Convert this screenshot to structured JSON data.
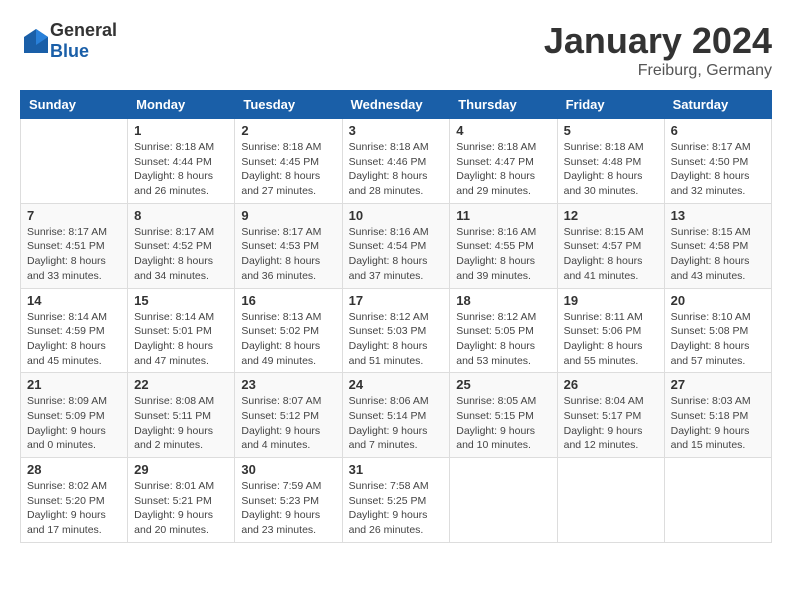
{
  "header": {
    "logo": {
      "general": "General",
      "blue": "Blue"
    },
    "title": "January 2024",
    "location": "Freiburg, Germany"
  },
  "days_of_week": [
    "Sunday",
    "Monday",
    "Tuesday",
    "Wednesday",
    "Thursday",
    "Friday",
    "Saturday"
  ],
  "weeks": [
    [
      {
        "day": "",
        "sunrise": "",
        "sunset": "",
        "daylight": ""
      },
      {
        "day": "1",
        "sunrise": "Sunrise: 8:18 AM",
        "sunset": "Sunset: 4:44 PM",
        "daylight": "Daylight: 8 hours and 26 minutes."
      },
      {
        "day": "2",
        "sunrise": "Sunrise: 8:18 AM",
        "sunset": "Sunset: 4:45 PM",
        "daylight": "Daylight: 8 hours and 27 minutes."
      },
      {
        "day": "3",
        "sunrise": "Sunrise: 8:18 AM",
        "sunset": "Sunset: 4:46 PM",
        "daylight": "Daylight: 8 hours and 28 minutes."
      },
      {
        "day": "4",
        "sunrise": "Sunrise: 8:18 AM",
        "sunset": "Sunset: 4:47 PM",
        "daylight": "Daylight: 8 hours and 29 minutes."
      },
      {
        "day": "5",
        "sunrise": "Sunrise: 8:18 AM",
        "sunset": "Sunset: 4:48 PM",
        "daylight": "Daylight: 8 hours and 30 minutes."
      },
      {
        "day": "6",
        "sunrise": "Sunrise: 8:17 AM",
        "sunset": "Sunset: 4:50 PM",
        "daylight": "Daylight: 8 hours and 32 minutes."
      }
    ],
    [
      {
        "day": "7",
        "sunrise": "Sunrise: 8:17 AM",
        "sunset": "Sunset: 4:51 PM",
        "daylight": "Daylight: 8 hours and 33 minutes."
      },
      {
        "day": "8",
        "sunrise": "Sunrise: 8:17 AM",
        "sunset": "Sunset: 4:52 PM",
        "daylight": "Daylight: 8 hours and 34 minutes."
      },
      {
        "day": "9",
        "sunrise": "Sunrise: 8:17 AM",
        "sunset": "Sunset: 4:53 PM",
        "daylight": "Daylight: 8 hours and 36 minutes."
      },
      {
        "day": "10",
        "sunrise": "Sunrise: 8:16 AM",
        "sunset": "Sunset: 4:54 PM",
        "daylight": "Daylight: 8 hours and 37 minutes."
      },
      {
        "day": "11",
        "sunrise": "Sunrise: 8:16 AM",
        "sunset": "Sunset: 4:55 PM",
        "daylight": "Daylight: 8 hours and 39 minutes."
      },
      {
        "day": "12",
        "sunrise": "Sunrise: 8:15 AM",
        "sunset": "Sunset: 4:57 PM",
        "daylight": "Daylight: 8 hours and 41 minutes."
      },
      {
        "day": "13",
        "sunrise": "Sunrise: 8:15 AM",
        "sunset": "Sunset: 4:58 PM",
        "daylight": "Daylight: 8 hours and 43 minutes."
      }
    ],
    [
      {
        "day": "14",
        "sunrise": "Sunrise: 8:14 AM",
        "sunset": "Sunset: 4:59 PM",
        "daylight": "Daylight: 8 hours and 45 minutes."
      },
      {
        "day": "15",
        "sunrise": "Sunrise: 8:14 AM",
        "sunset": "Sunset: 5:01 PM",
        "daylight": "Daylight: 8 hours and 47 minutes."
      },
      {
        "day": "16",
        "sunrise": "Sunrise: 8:13 AM",
        "sunset": "Sunset: 5:02 PM",
        "daylight": "Daylight: 8 hours and 49 minutes."
      },
      {
        "day": "17",
        "sunrise": "Sunrise: 8:12 AM",
        "sunset": "Sunset: 5:03 PM",
        "daylight": "Daylight: 8 hours and 51 minutes."
      },
      {
        "day": "18",
        "sunrise": "Sunrise: 8:12 AM",
        "sunset": "Sunset: 5:05 PM",
        "daylight": "Daylight: 8 hours and 53 minutes."
      },
      {
        "day": "19",
        "sunrise": "Sunrise: 8:11 AM",
        "sunset": "Sunset: 5:06 PM",
        "daylight": "Daylight: 8 hours and 55 minutes."
      },
      {
        "day": "20",
        "sunrise": "Sunrise: 8:10 AM",
        "sunset": "Sunset: 5:08 PM",
        "daylight": "Daylight: 8 hours and 57 minutes."
      }
    ],
    [
      {
        "day": "21",
        "sunrise": "Sunrise: 8:09 AM",
        "sunset": "Sunset: 5:09 PM",
        "daylight": "Daylight: 9 hours and 0 minutes."
      },
      {
        "day": "22",
        "sunrise": "Sunrise: 8:08 AM",
        "sunset": "Sunset: 5:11 PM",
        "daylight": "Daylight: 9 hours and 2 minutes."
      },
      {
        "day": "23",
        "sunrise": "Sunrise: 8:07 AM",
        "sunset": "Sunset: 5:12 PM",
        "daylight": "Daylight: 9 hours and 4 minutes."
      },
      {
        "day": "24",
        "sunrise": "Sunrise: 8:06 AM",
        "sunset": "Sunset: 5:14 PM",
        "daylight": "Daylight: 9 hours and 7 minutes."
      },
      {
        "day": "25",
        "sunrise": "Sunrise: 8:05 AM",
        "sunset": "Sunset: 5:15 PM",
        "daylight": "Daylight: 9 hours and 10 minutes."
      },
      {
        "day": "26",
        "sunrise": "Sunrise: 8:04 AM",
        "sunset": "Sunset: 5:17 PM",
        "daylight": "Daylight: 9 hours and 12 minutes."
      },
      {
        "day": "27",
        "sunrise": "Sunrise: 8:03 AM",
        "sunset": "Sunset: 5:18 PM",
        "daylight": "Daylight: 9 hours and 15 minutes."
      }
    ],
    [
      {
        "day": "28",
        "sunrise": "Sunrise: 8:02 AM",
        "sunset": "Sunset: 5:20 PM",
        "daylight": "Daylight: 9 hours and 17 minutes."
      },
      {
        "day": "29",
        "sunrise": "Sunrise: 8:01 AM",
        "sunset": "Sunset: 5:21 PM",
        "daylight": "Daylight: 9 hours and 20 minutes."
      },
      {
        "day": "30",
        "sunrise": "Sunrise: 7:59 AM",
        "sunset": "Sunset: 5:23 PM",
        "daylight": "Daylight: 9 hours and 23 minutes."
      },
      {
        "day": "31",
        "sunrise": "Sunrise: 7:58 AM",
        "sunset": "Sunset: 5:25 PM",
        "daylight": "Daylight: 9 hours and 26 minutes."
      },
      {
        "day": "",
        "sunrise": "",
        "sunset": "",
        "daylight": ""
      },
      {
        "day": "",
        "sunrise": "",
        "sunset": "",
        "daylight": ""
      },
      {
        "day": "",
        "sunrise": "",
        "sunset": "",
        "daylight": ""
      }
    ]
  ]
}
